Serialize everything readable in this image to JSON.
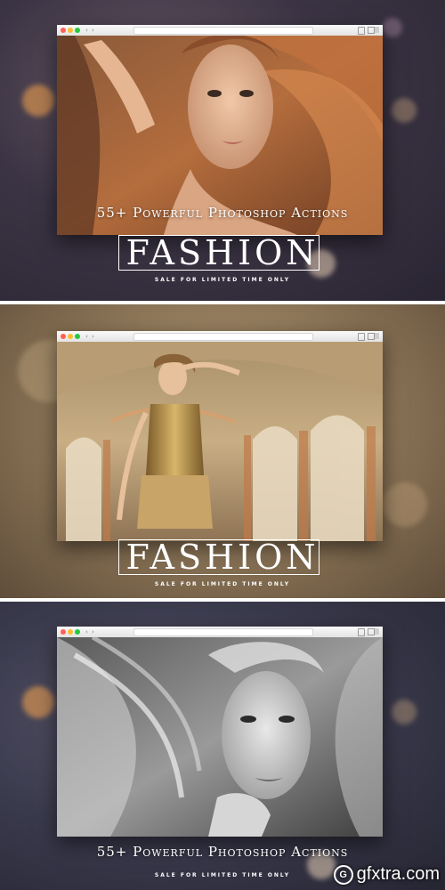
{
  "panels": [
    {
      "caption": "55+ Powerful Photoshop Actions",
      "brand": "FASHION",
      "tagline": "SALE FOR LIMITED TIME ONLY"
    },
    {
      "brand": "FASHION",
      "tagline": "SALE FOR LIMITED TIME ONLY"
    },
    {
      "caption": "55+ Powerful Photoshop Actions",
      "tagline": "SALE FOR LIMITED TIME ONLY"
    }
  ],
  "watermark": {
    "text": "gfxtra.com",
    "icon_letter": "G"
  },
  "colors": {
    "panel1_accent": "#c1723f",
    "panel2_accent": "#b8934f",
    "panel3_accent": "#8a8a8a"
  },
  "browser_icons": [
    "close-dot",
    "minimize-dot",
    "zoom-dot",
    "back-arrow",
    "forward-arrow",
    "share-icon",
    "tabs-icon"
  ]
}
